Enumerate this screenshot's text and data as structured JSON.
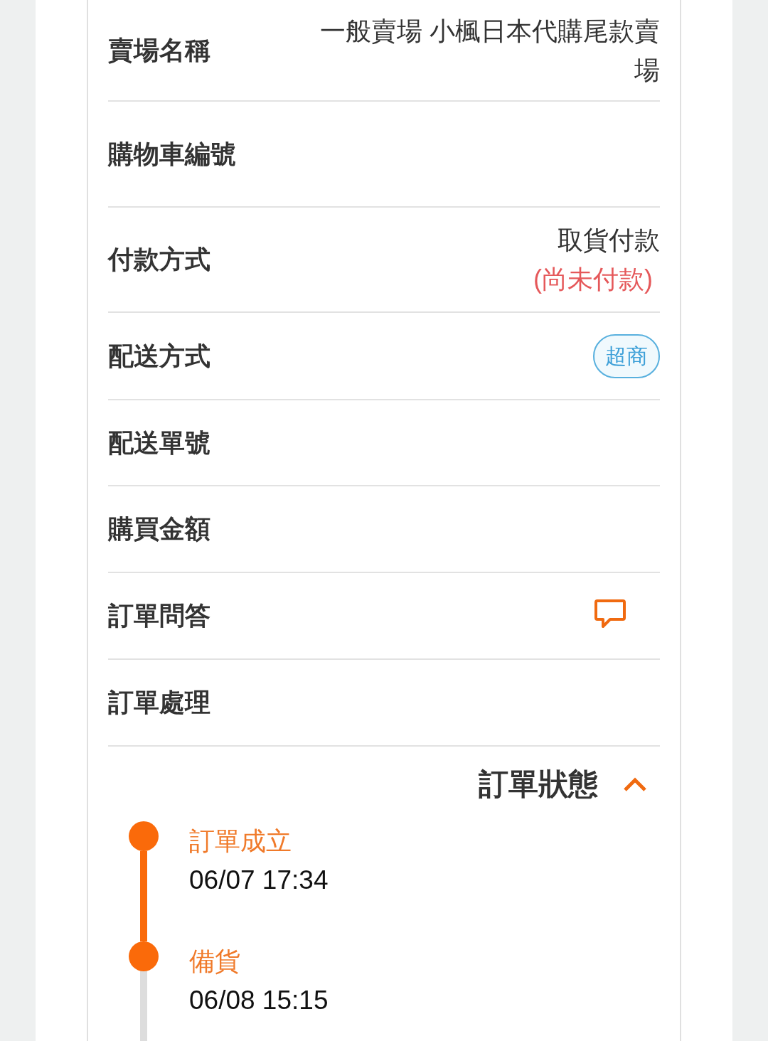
{
  "detail_rows": [
    {
      "label": "賣場名稱",
      "kind": "text",
      "value": "一般賣場 小楓日本代購尾款賣場"
    },
    {
      "label": "購物車編號",
      "kind": "empty"
    },
    {
      "label": "付款方式",
      "kind": "text",
      "value": "取貨付款",
      "note": "(尚未付款)"
    },
    {
      "label": "配送方式",
      "kind": "badge",
      "value": "超商"
    },
    {
      "label": "配送單號",
      "kind": "empty"
    },
    {
      "label": "購買金額",
      "kind": "empty"
    },
    {
      "label": "訂單問答",
      "kind": "chat"
    },
    {
      "label": "訂單處理",
      "kind": "empty"
    }
  ],
  "order_status": {
    "title": "訂單狀態",
    "expanded": true,
    "steps": [
      {
        "label": "訂單成立",
        "time": "06/07 17:34",
        "done": true
      },
      {
        "label": "備貨",
        "time": "06/08 15:15",
        "done": true
      }
    ]
  }
}
